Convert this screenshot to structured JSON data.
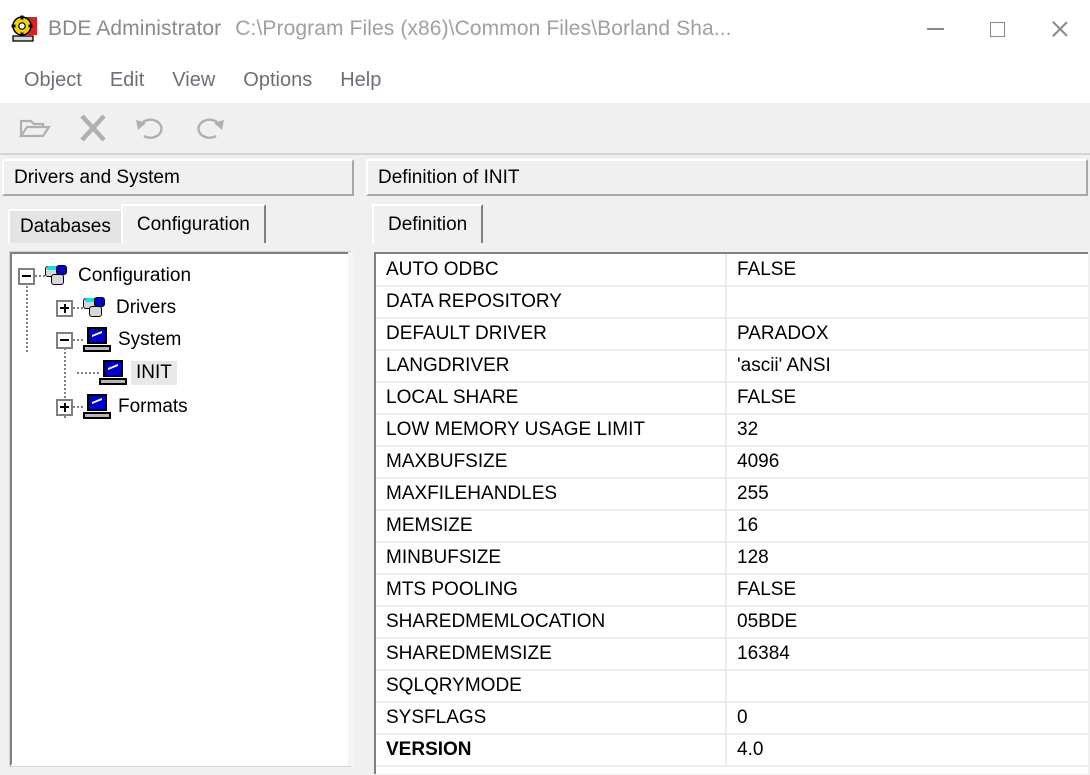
{
  "window": {
    "app_title": "BDE Administrator",
    "path_title": "C:\\Program Files (x86)\\Common Files\\Borland Sha...",
    "icon": "bde-app-icon",
    "controls": {
      "minimize": "minimize-icon",
      "maximize": "maximize-icon",
      "close": "close-icon"
    }
  },
  "menubar": {
    "items": [
      {
        "label": "Object"
      },
      {
        "label": "Edit"
      },
      {
        "label": "View"
      },
      {
        "label": "Options"
      },
      {
        "label": "Help"
      }
    ]
  },
  "toolbar": {
    "buttons": [
      {
        "icon": "open-folder-icon",
        "enabled": false
      },
      {
        "icon": "delete-x-icon",
        "enabled": false
      },
      {
        "icon": "undo-arrow-icon",
        "enabled": false
      },
      {
        "icon": "redo-arrow-icon",
        "enabled": false
      }
    ]
  },
  "left_panel": {
    "header": "Drivers and System",
    "tabs": [
      {
        "label": "Databases",
        "active": false
      },
      {
        "label": "Configuration",
        "active": true
      }
    ],
    "tree": {
      "root": {
        "label": "Configuration",
        "icon": "database-icon",
        "expander": "minus"
      },
      "children": [
        {
          "label": "Drivers",
          "icon": "database-icon",
          "expander": "plus"
        },
        {
          "label": "System",
          "icon": "computer-icon",
          "expander": "minus"
        }
      ],
      "system_children": [
        {
          "label": "INIT",
          "icon": "computer-icon",
          "expander": "none",
          "selected": true
        },
        {
          "label": "Formats",
          "icon": "computer-icon",
          "expander": "plus",
          "selected": false
        }
      ]
    }
  },
  "right_panel": {
    "header": "Definition of INIT",
    "tabs": [
      {
        "label": "Definition",
        "active": true
      }
    ],
    "grid": {
      "rows": [
        {
          "key": "AUTO ODBC",
          "value": "FALSE",
          "bold": false
        },
        {
          "key": "DATA REPOSITORY",
          "value": "",
          "bold": false
        },
        {
          "key": "DEFAULT DRIVER",
          "value": "PARADOX",
          "bold": false
        },
        {
          "key": "LANGDRIVER",
          "value": "'ascii' ANSI",
          "bold": false
        },
        {
          "key": "LOCAL SHARE",
          "value": "FALSE",
          "bold": false
        },
        {
          "key": "LOW MEMORY USAGE LIMIT",
          "value": "32",
          "bold": false
        },
        {
          "key": "MAXBUFSIZE",
          "value": "4096",
          "bold": false
        },
        {
          "key": "MAXFILEHANDLES",
          "value": "255",
          "bold": false
        },
        {
          "key": "MEMSIZE",
          "value": "16",
          "bold": false
        },
        {
          "key": "MINBUFSIZE",
          "value": "128",
          "bold": false
        },
        {
          "key": "MTS POOLING",
          "value": "FALSE",
          "bold": false
        },
        {
          "key": "SHAREDMEMLOCATION",
          "value": "05BDE",
          "bold": false
        },
        {
          "key": "SHAREDMEMSIZE",
          "value": "16384",
          "bold": false
        },
        {
          "key": "SQLQRYMODE",
          "value": "",
          "bold": false
        },
        {
          "key": "SYSFLAGS",
          "value": "0",
          "bold": false
        },
        {
          "key": "VERSION",
          "value": "4.0",
          "bold": true
        }
      ]
    }
  },
  "colors": {
    "window_bg": "#f0f0f0",
    "panel_bg": "#ffffff",
    "title_text": "#8a8a8a",
    "menu_text": "#6e6e7a",
    "grid_line": "#ececec",
    "selection": "#e8e8e8",
    "icon_blue": "#0000d0",
    "icon_cyan": "#00e5ee"
  }
}
